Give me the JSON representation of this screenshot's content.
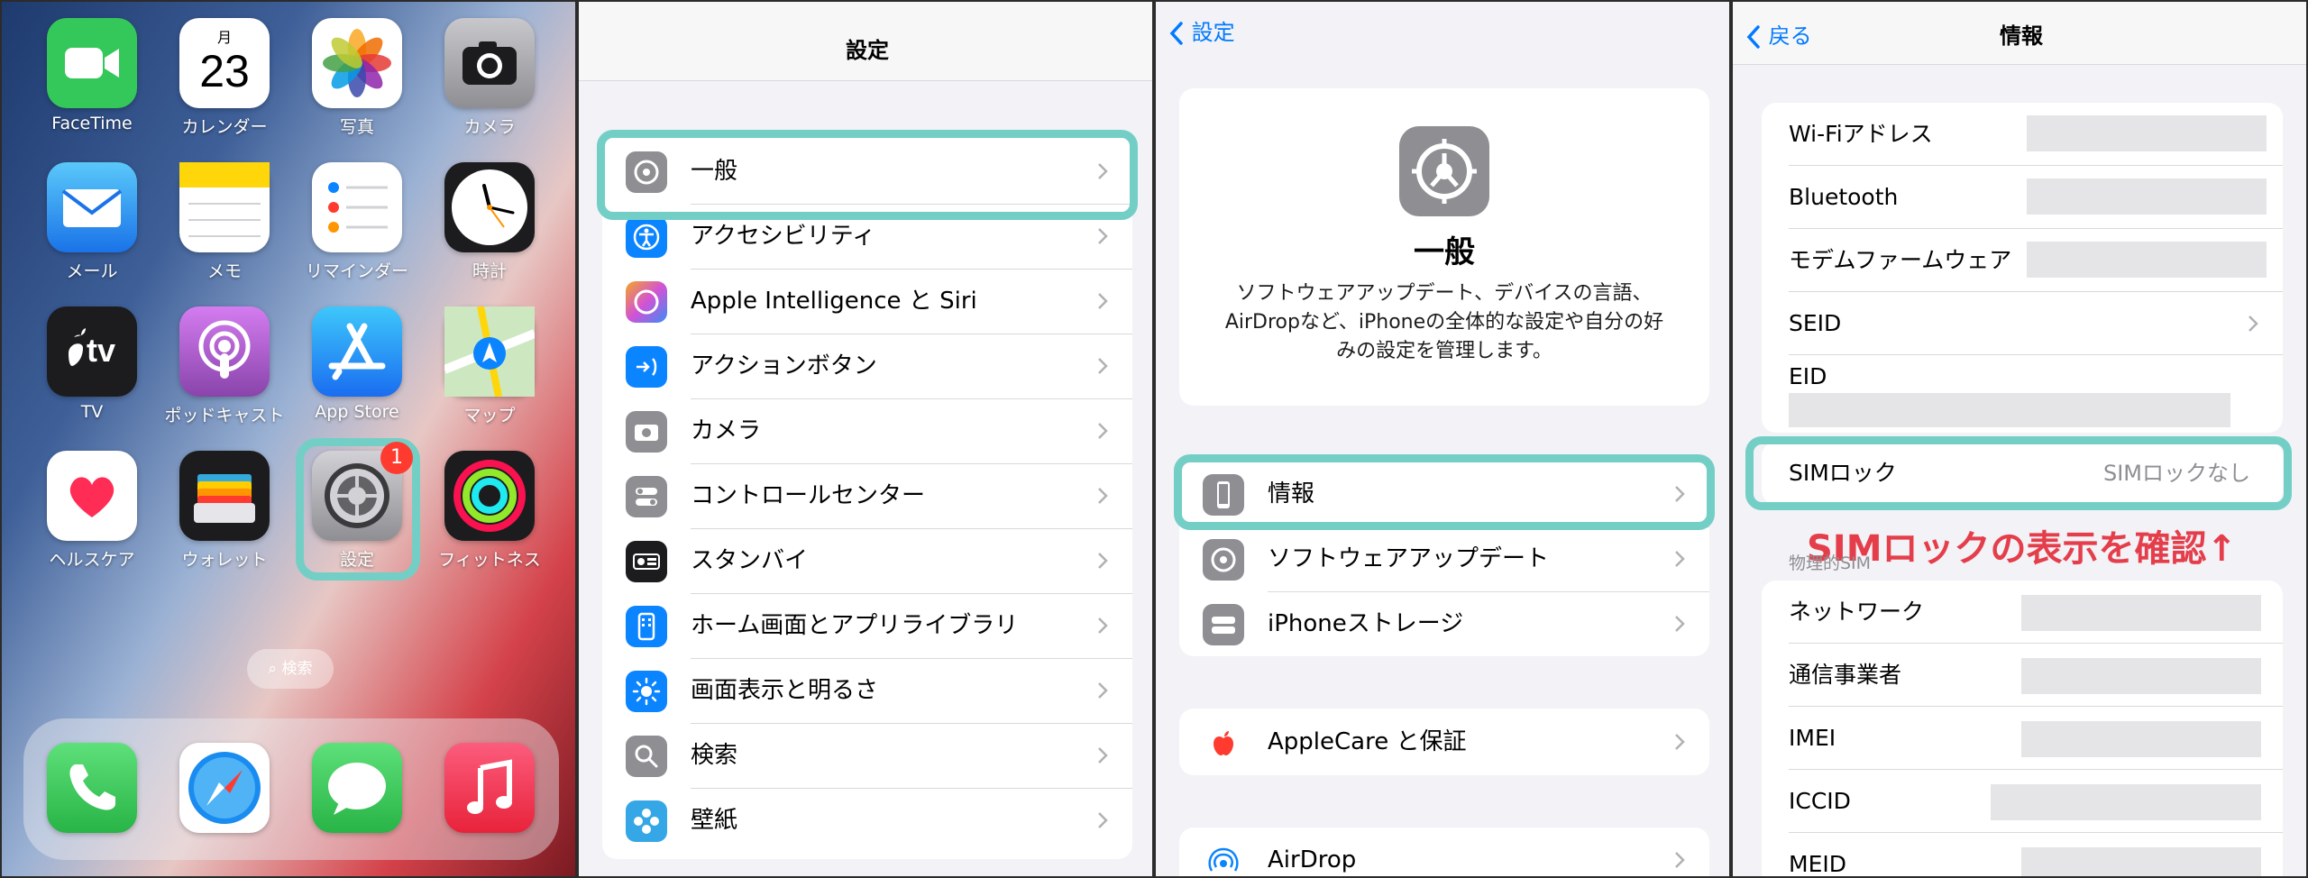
{
  "home": {
    "apps": [
      {
        "label": "FaceTime",
        "icon": "facetime-icon"
      },
      {
        "label": "カレンダー",
        "icon": "calendar-icon",
        "month": "月",
        "day": "23"
      },
      {
        "label": "写真",
        "icon": "photos-icon"
      },
      {
        "label": "カメラ",
        "icon": "camera-icon"
      },
      {
        "label": "メール",
        "icon": "mail-icon"
      },
      {
        "label": "メモ",
        "icon": "notes-icon"
      },
      {
        "label": "リマインダー",
        "icon": "reminders-icon"
      },
      {
        "label": "時計",
        "icon": "clock-icon"
      },
      {
        "label": "TV",
        "icon": "tv-icon",
        "glyph": "tv"
      },
      {
        "label": "ポッドキャスト",
        "icon": "podcasts-icon"
      },
      {
        "label": "App Store",
        "icon": "app-store-icon"
      },
      {
        "label": "マップ",
        "icon": "maps-icon"
      },
      {
        "label": "ヘルスケア",
        "icon": "health-icon"
      },
      {
        "label": "ウォレット",
        "icon": "wallet-icon"
      },
      {
        "label": "設定",
        "icon": "settings-icon",
        "badge": "1"
      },
      {
        "label": "フィットネス",
        "icon": "fitness-icon"
      }
    ],
    "search_label": "検索",
    "dock": [
      "phone-icon",
      "safari-icon",
      "messages-icon",
      "music-icon"
    ]
  },
  "settings": {
    "title": "設定",
    "items": [
      {
        "label": "一般",
        "icon": "gear-icon",
        "color": "#8e8e93"
      },
      {
        "label": "アクセシビリティ",
        "icon": "accessibility-icon",
        "color": "#0a84ff"
      },
      {
        "label": "Apple Intelligence と Siri",
        "icon": "siri-icon",
        "color": "#c86dd7"
      },
      {
        "label": "アクションボタン",
        "icon": "action-button-icon",
        "color": "#0a84ff"
      },
      {
        "label": "カメラ",
        "icon": "camera-icon",
        "color": "#8e8e93"
      },
      {
        "label": "コントロールセンター",
        "icon": "control-center-icon",
        "color": "#8e8e93"
      },
      {
        "label": "スタンバイ",
        "icon": "standby-icon",
        "color": "#1c1c1e"
      },
      {
        "label": "ホーム画面とアプリライブラリ",
        "icon": "home-screen-icon",
        "color": "#0a84ff"
      },
      {
        "label": "画面表示と明るさ",
        "icon": "brightness-icon",
        "color": "#0a84ff"
      },
      {
        "label": "検索",
        "icon": "search-icon",
        "color": "#8e8e93"
      },
      {
        "label": "壁紙",
        "icon": "wallpaper-icon",
        "color": "#35a7e6"
      }
    ]
  },
  "general": {
    "back_label": "設定",
    "title": "一般",
    "description": "ソフトウェアアップデート、デバイスの言語、AirDropなど、iPhoneの全体的な設定や自分の好みの設定を管理します。",
    "group1": [
      {
        "label": "情報",
        "icon": "iphone-icon"
      },
      {
        "label": "ソフトウェアアップデート",
        "icon": "gear-badge-icon"
      },
      {
        "label": "iPhoneストレージ",
        "icon": "storage-icon"
      }
    ],
    "group2": [
      {
        "label": "AppleCare と保証",
        "icon": "apple-logo-icon"
      }
    ],
    "group3": [
      {
        "label": "AirDrop",
        "icon": "airdrop-icon"
      }
    ]
  },
  "info": {
    "back_label": "戻る",
    "title": "情報",
    "rows1": [
      {
        "label": "Wi-Fiアドレス"
      },
      {
        "label": "Bluetooth"
      },
      {
        "label": "モデムファームウェア"
      },
      {
        "label": "SEID"
      },
      {
        "label": "EID"
      }
    ],
    "sim_lock_label": "SIMロック",
    "sim_lock_value": "SIMロックなし",
    "caption": "SIMロックの表示を確認↑",
    "section_header": "物理的SIM",
    "rows2": [
      {
        "label": "ネットワーク"
      },
      {
        "label": "通信事業者"
      },
      {
        "label": "IMEI"
      },
      {
        "label": "ICCID"
      },
      {
        "label": "MEID"
      }
    ]
  },
  "colors": {
    "highlight": "#73cfc6",
    "accent": "#007aff",
    "caption": "#e53e4b"
  }
}
